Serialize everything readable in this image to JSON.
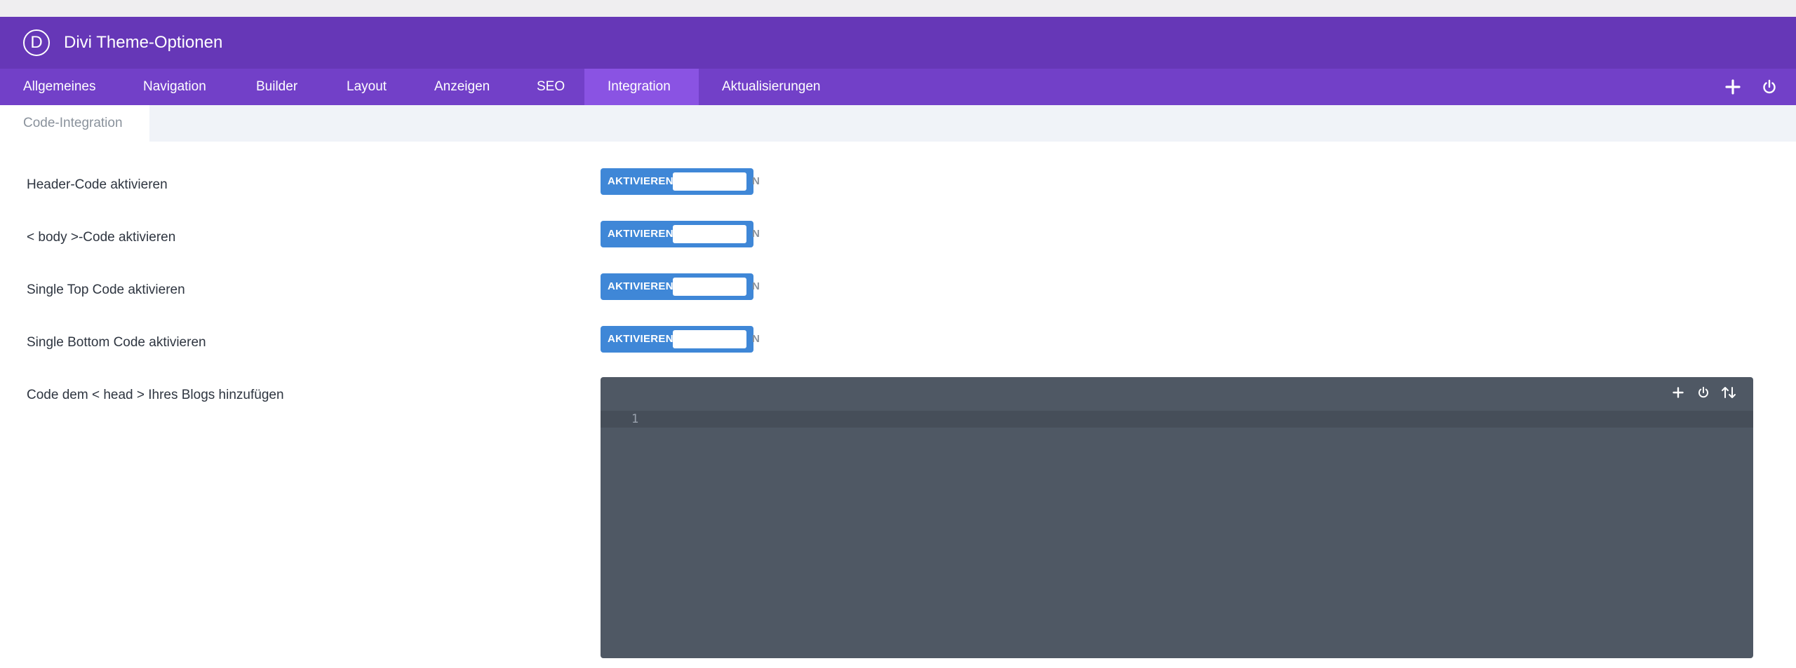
{
  "app": {
    "logo_letter": "D",
    "title": "Divi Theme-Optionen"
  },
  "tabs": [
    {
      "label": "Allgemeines",
      "active": false
    },
    {
      "label": "Navigation",
      "active": false
    },
    {
      "label": "Builder",
      "active": false
    },
    {
      "label": "Layout",
      "active": false
    },
    {
      "label": "Anzeigen",
      "active": false
    },
    {
      "label": "SEO",
      "active": false
    },
    {
      "label": "Integration",
      "active": true
    },
    {
      "label": "Aktualisierungen",
      "active": false
    }
  ],
  "tab_icons": [
    "plus-icon",
    "power-icon"
  ],
  "subtabs": [
    {
      "label": "Code-Integration",
      "active": true
    }
  ],
  "settings": [
    {
      "label": "Header-Code aktivieren",
      "toggle_on": "AKTIVIEREN",
      "toggle_off": "N"
    },
    {
      "label": "< body >-Code aktivieren",
      "toggle_on": "AKTIVIEREN",
      "toggle_off": "N"
    },
    {
      "label": "Single Top Code aktivieren",
      "toggle_on": "AKTIVIEREN",
      "toggle_off": "N"
    },
    {
      "label": "Single Bottom Code aktivieren",
      "toggle_on": "AKTIVIEREN",
      "toggle_off": "N"
    }
  ],
  "code_editor": {
    "label": "Code dem < head > Ihres Blogs hinzufügen",
    "line_number": "1",
    "content": "",
    "icons": [
      "plus-icon",
      "power-icon",
      "sort-arrows-icon"
    ]
  },
  "colors": {
    "titlebar": "#6637b7",
    "tabbar": "#7240c8",
    "active_tab": "#8a53e3",
    "toggle": "#3f87d7",
    "editor_bg": "#4f5864"
  }
}
